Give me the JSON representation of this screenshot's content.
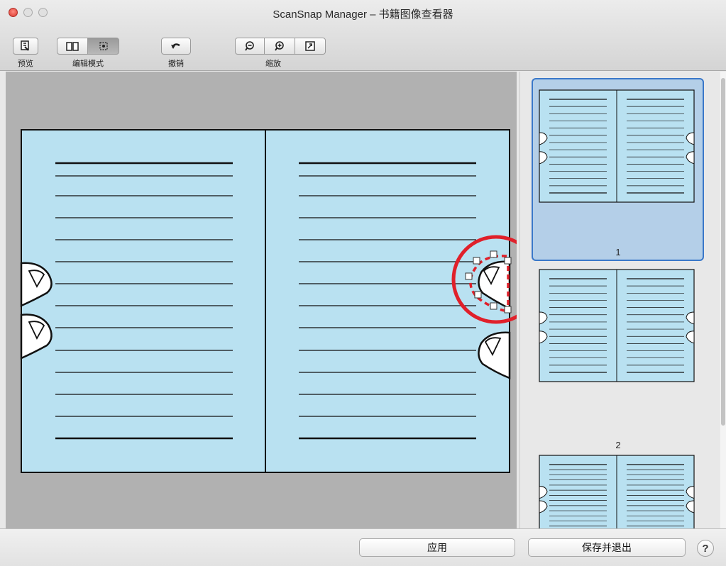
{
  "window": {
    "title": "ScanSnap Manager – 书籍图像查看器"
  },
  "toolbar": {
    "preview_label": "预览",
    "edit_mode_label": "编辑模式",
    "undo_label": "撤销",
    "zoom_label": "缩放"
  },
  "thumbnails": [
    {
      "page": "1"
    },
    {
      "page": "2"
    }
  ],
  "footer": {
    "apply_label": "应用",
    "save_exit_label": "保存并退出",
    "help_label": "?"
  },
  "colors": {
    "page": "#b9e1f1",
    "highlight": "#e0202a",
    "selection": "#3a78c9"
  }
}
